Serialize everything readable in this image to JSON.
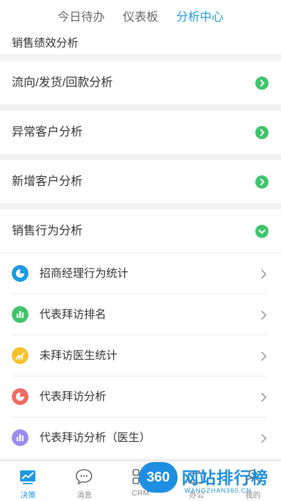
{
  "header": {
    "tabs": [
      {
        "label": "今日待办",
        "active": false
      },
      {
        "label": "仪表板",
        "active": false
      },
      {
        "label": "分析中心",
        "active": true
      }
    ]
  },
  "partial_row": {
    "label": "销售绩效分析"
  },
  "sections": [
    {
      "label": "流向/发货/回款分析",
      "state": "collapsed"
    },
    {
      "label": "异常客户分析",
      "state": "collapsed"
    },
    {
      "label": "新增客户分析",
      "state": "collapsed"
    },
    {
      "label": "销售行为分析",
      "state": "expanded"
    }
  ],
  "sub_items": [
    {
      "label": "招商经理行为统计",
      "icon": "pie-chart-icon",
      "color": "#1e9be0"
    },
    {
      "label": "代表拜访排名",
      "icon": "bar-chart-icon",
      "color": "#3fc46b"
    },
    {
      "label": "未拜访医生统计",
      "icon": "line-chart-icon",
      "color": "#f5c22b"
    },
    {
      "label": "代表拜访分析",
      "icon": "pie-chart-icon",
      "color": "#ef6a63"
    },
    {
      "label": "代表拜访分析（医生）",
      "icon": "bar-chart-icon",
      "color": "#9b8cf0"
    }
  ],
  "bottom_nav": [
    {
      "label": "决策",
      "icon": "chart-monitor-icon",
      "active": true
    },
    {
      "label": "消息",
      "icon": "chat-bubble-icon",
      "active": false
    },
    {
      "label": "CRM",
      "icon": "grid-icon",
      "active": false
    },
    {
      "label": "办公",
      "icon": "briefcase-icon",
      "active": false
    },
    {
      "label": "我的",
      "icon": "person-icon",
      "active": false
    }
  ],
  "watermark": {
    "badge": "360",
    "title": "网站排行榜",
    "subtitle": "WANGZHAN360.CN"
  },
  "colors": {
    "accent": "#1e9be0",
    "expand_green": "#3fc46b"
  }
}
